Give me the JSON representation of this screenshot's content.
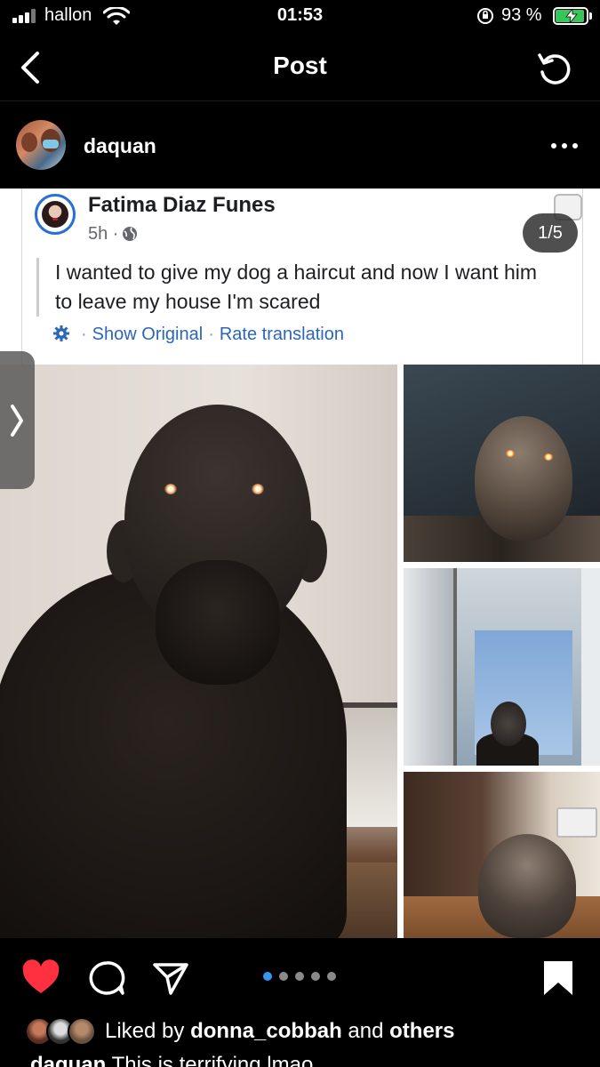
{
  "status_bar": {
    "carrier": "hallon",
    "time": "01:53",
    "battery_percent": "93 %",
    "battery_level": 0.93,
    "icons": [
      "signal-icon",
      "wifi-icon",
      "orientation-lock-icon",
      "battery-charging-icon"
    ]
  },
  "nav": {
    "title": "Post",
    "back_icon": "chevron-left-icon",
    "refresh_icon": "refresh-icon"
  },
  "post": {
    "username": "daquan",
    "more_icon": "more-horizontal-icon"
  },
  "embedded_post": {
    "author": "Fatima Diaz Funes",
    "time": "5h ·",
    "privacy_icon": "globe-icon",
    "text": "I wanted to give my dog a haircut and now I want him to leave my house I'm scared",
    "translate_icon": "gear-icon",
    "show_original": "Show Original",
    "separator": "·",
    "rate_translation": "Rate translation",
    "counter": "1/5"
  },
  "carousel": {
    "total": 5,
    "current": 1,
    "active_color": "#3797f0"
  },
  "actions": {
    "like_icon": "heart-filled-icon",
    "like_color": "#ff3040",
    "comment_icon": "comment-icon",
    "share_icon": "send-icon",
    "save_icon": "bookmark-filled-icon"
  },
  "likes": {
    "prefix": "Liked by",
    "user": "donna_cobbah",
    "and": "and",
    "others": "others"
  },
  "caption": {
    "user": "daquan",
    "text": "This is terrifying lmao"
  }
}
